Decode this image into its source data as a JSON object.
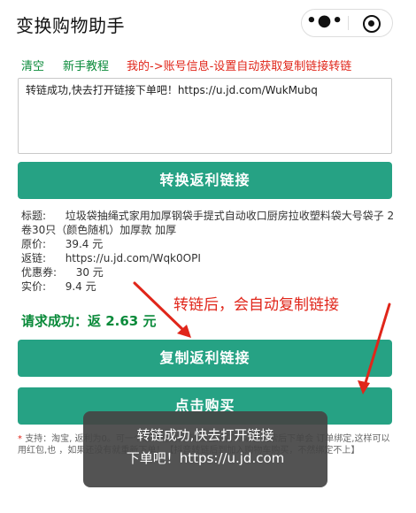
{
  "header": {
    "title": "变换购物助手",
    "more_icon": "more-dots-icon",
    "close_icon": "target-close-icon"
  },
  "links": {
    "clear": "清空",
    "tutorial": "新手教程",
    "account": "我的->账号信息-设置自动获取复制链接转链"
  },
  "input": {
    "value": "转链成功,快去打开链接下单吧！https://u.jd.com/WukMubq"
  },
  "buttons": {
    "convert": "转换返利链接",
    "copy": "复制返利链接",
    "buy": "点击购买"
  },
  "result": {
    "title_label": "标题:",
    "title_value": "垃圾袋抽绳式家用加厚钢袋手提式自动收口厨房拉收塑料袋大号袋子 2卷30只（颜色随机）加厚款 加厚",
    "price_label": "原价:",
    "price_value": "39.4 元",
    "link_label": "返链:",
    "link_value": "https://u.jd.com/Wqk0OPI",
    "coupon_label": "优惠券:",
    "coupon_value": "30 元",
    "paid_label": "实价:",
    "paid_value": "9.4 元",
    "success": "请求成功：返 2.63 元"
  },
  "annotation": "转链后，会自动复制链接",
  "notes": {
    "star": "*",
    "text": "支持：淘宝,                                                          返利为0。可一个账户选购商                                                          链接直接打开或者搜索后下单会                                                          订单绑定,这样可以用红包,也                                                          ，如果还没有就重新下单！【抖音转链后到加入购物车购买，不然绑定不上】"
  },
  "toast": {
    "line1": "转链成功,快去打开链接",
    "line2": "下单吧！https://u.jd.com"
  },
  "colors": {
    "primary_green": "#26a284",
    "link_green": "#0a8a3a",
    "accent_red": "#e0261a"
  }
}
